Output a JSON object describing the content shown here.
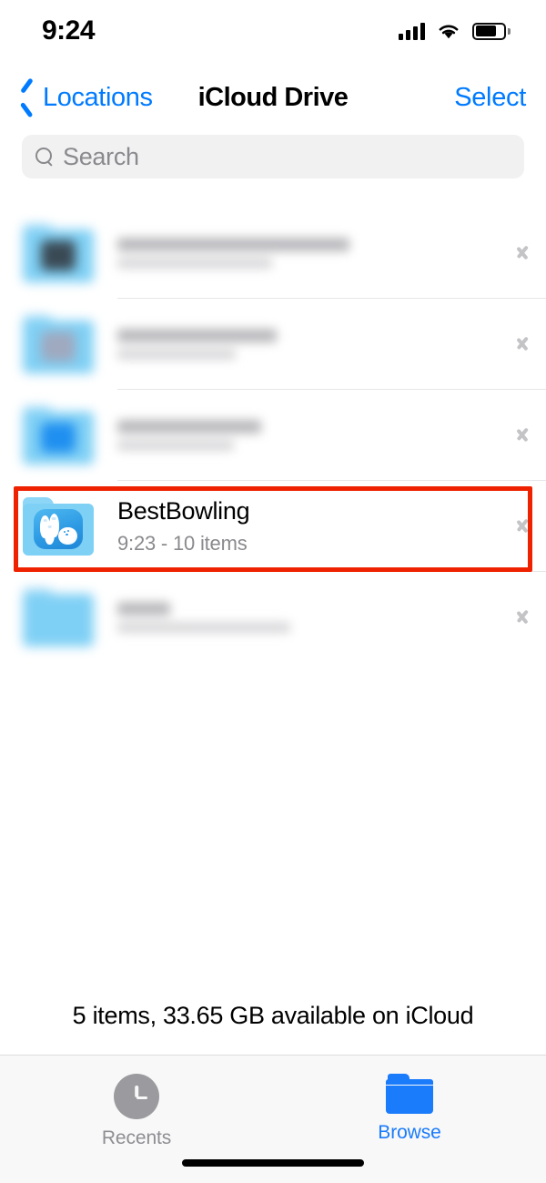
{
  "status_bar": {
    "time": "9:24",
    "signal_icon": "cellular-signal-icon",
    "wifi_icon": "wifi-icon",
    "battery_icon": "battery-icon",
    "battery_level_percent": 70
  },
  "nav_bar": {
    "back_label": "Locations",
    "back_icon": "chevron-left-icon",
    "title": "iCloud Drive",
    "select_label": "Select"
  },
  "search": {
    "placeholder": "Search",
    "value": "",
    "icon": "search-icon"
  },
  "list": {
    "rows": [
      {
        "title": "",
        "subtitle": "",
        "redacted": true,
        "icon": "folder-icon",
        "chevron": "chevron-right-icon",
        "thumb_color": "#3a4a55"
      },
      {
        "title": "",
        "subtitle": "",
        "redacted": true,
        "icon": "folder-icon",
        "chevron": "chevron-right-icon",
        "thumb_color": "#9fa9bf"
      },
      {
        "title": "",
        "subtitle": "",
        "redacted": true,
        "icon": "folder-icon",
        "chevron": "chevron-right-icon",
        "thumb_color": "#1f8ff0"
      },
      {
        "title": "BestBowling",
        "subtitle": "9:23 - 10 items",
        "redacted": false,
        "icon": "bowling-folder-icon",
        "chevron": "chevron-right-icon",
        "highlighted": true
      },
      {
        "title": "",
        "subtitle": "",
        "redacted": true,
        "icon": "folder-icon",
        "chevron": "chevron-right-icon",
        "thumb_color": "#6ecbf4"
      }
    ]
  },
  "footer": {
    "count_text": "5 items, 33.65 GB available on iCloud"
  },
  "tab_bar": {
    "items": [
      {
        "label": "Recents",
        "icon": "clock-icon",
        "active": false
      },
      {
        "label": "Browse",
        "icon": "folder-icon",
        "active": true
      }
    ]
  },
  "colors": {
    "accent_blue": "#007AFF",
    "tab_active_blue": "#1a7bfb",
    "highlight_red": "#ee2200",
    "secondary_text": "#8a8a8e",
    "search_bg": "#f1f1f2",
    "separator": "#e6e6e8",
    "tab_bar_bg": "#f8f8f8"
  }
}
